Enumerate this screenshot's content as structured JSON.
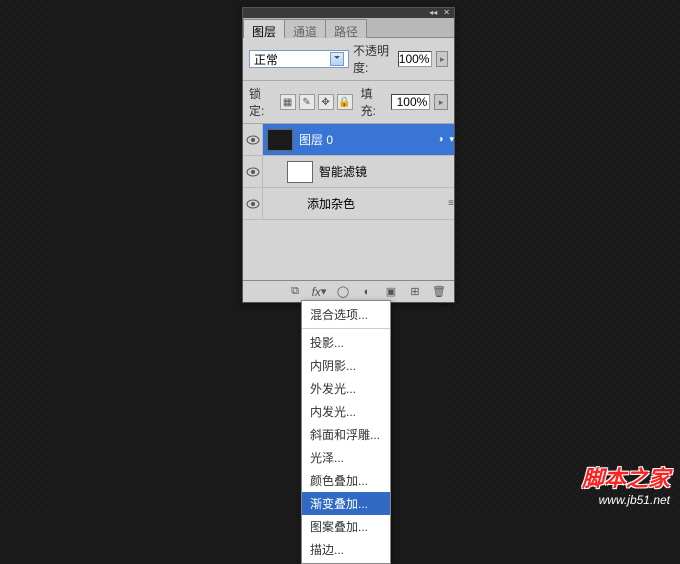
{
  "tabs": {
    "layers": "图层",
    "channels": "通道",
    "paths": "路径"
  },
  "blend": {
    "mode": "正常",
    "opacity_label": "不透明度:",
    "opacity_value": "100%"
  },
  "lock": {
    "label": "锁定:",
    "fill_label": "填充:",
    "fill_value": "100%"
  },
  "layers_list": [
    {
      "name": "图层 0"
    },
    {
      "name": "智能滤镜"
    },
    {
      "name": "添加杂色"
    }
  ],
  "fx_menu": {
    "items": [
      "混合选项...",
      "投影...",
      "内阴影...",
      "外发光...",
      "内发光...",
      "斜面和浮雕...",
      "光泽...",
      "颜色叠加...",
      "渐变叠加...",
      "图案叠加...",
      "描边..."
    ],
    "selected_index": 8
  },
  "watermark": {
    "line1": "脚本之家",
    "line2": "www.jb51.net"
  }
}
